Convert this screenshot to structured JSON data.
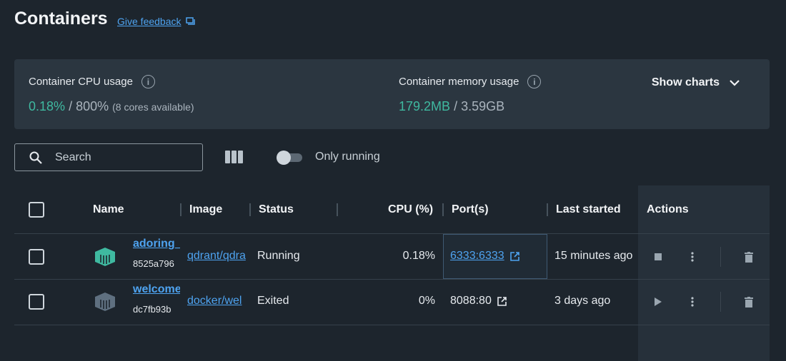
{
  "header": {
    "title": "Containers",
    "feedback_label": "Give feedback"
  },
  "stats": {
    "cpu_label": "Container CPU usage",
    "cpu_value": "0.18%",
    "cpu_total": "/ 800%",
    "cpu_cores": "(8 cores available)",
    "memory_label": "Container memory usage",
    "memory_value": "179.2MB",
    "memory_total": "/ 3.59GB",
    "show_charts_label": "Show charts"
  },
  "toolbar": {
    "search_placeholder": "Search",
    "only_running_label": "Only running",
    "only_running_on": false
  },
  "table": {
    "columns": {
      "name": "Name",
      "image": "Image",
      "status": "Status",
      "cpu": "CPU (%)",
      "ports": "Port(s)",
      "last_started": "Last started",
      "actions": "Actions"
    },
    "rows": [
      {
        "name": "adoring_",
        "id": "8525a796",
        "image": "qdrant/qdra",
        "status": "Running",
        "cpu": "0.18%",
        "ports": "6333:6333",
        "last_started": "15 minutes ago",
        "icon": "container-running-icon",
        "icon_color": "#3fb9a0"
      },
      {
        "name": "welcome",
        "id": "dc7fb93b",
        "image": "docker/wel",
        "status": "Exited",
        "cpu": "0%",
        "ports": "8088:80",
        "last_started": "3 days ago",
        "icon": "container-stopped-icon",
        "icon_color": "#5f7080"
      }
    ]
  },
  "colors": {
    "accent": "#4ea3f0",
    "green": "#3fb9a0",
    "background": "#1d252d",
    "panel": "#2b3640"
  }
}
